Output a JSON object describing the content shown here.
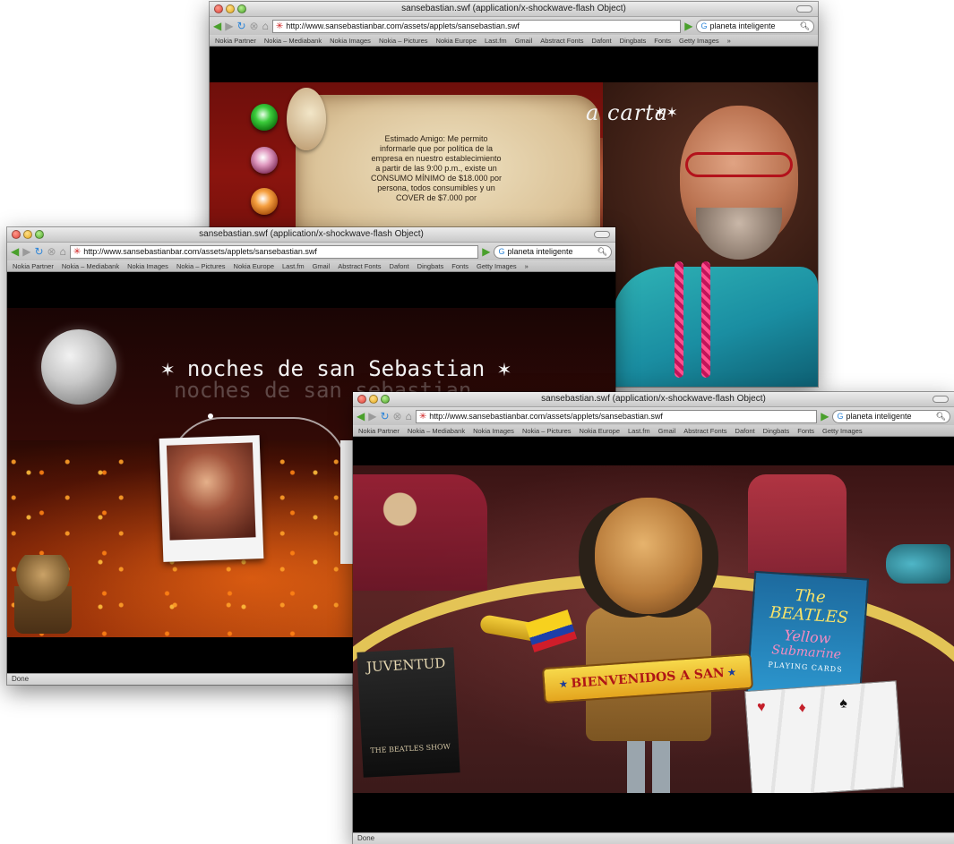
{
  "windows": {
    "carta": {
      "title": "sansebastian.swf (application/x-shockwave-flash Object)",
      "url": "http://www.sansebastianbar.com/assets/applets/sansebastian.swf",
      "search": "planeta inteligente",
      "letter": "Estimado Amigo: Me permito informarle que por política de la empresa en nuestro establecimiento a partir de las 9:00 p.m., existe un CONSUMO MÍNIMO de $18.000 por persona, todos consumibles y un COVER de $7.000 por",
      "logo_partial": "a carta",
      "stars": "✶✶"
    },
    "noches": {
      "title": "sansebastian.swf (application/x-shockwave-flash Object)",
      "url": "http://www.sansebastianbar.com/assets/applets/sansebastian.swf",
      "search": "planeta inteligente",
      "heading": "noches de san Sebastian",
      "heading_shadow": "noches de san sebastian",
      "status": "Done"
    },
    "bienvenidos": {
      "title": "sansebastian.swf (application/x-shockwave-flash Object)",
      "url": "http://www.sansebastianbar.com/assets/applets/sansebastian.swf",
      "search": "planeta inteligente",
      "banner": "BIENVENIDOS A SAN",
      "beatles_box": {
        "line1": "The BEATLES",
        "line2": "Yellow",
        "line3": "Submarine",
        "line4": "PLAYING CARDS"
      },
      "juventud": "JUVENTUD",
      "juventud_sub": "THE BEATLES SHOW",
      "status": "Done"
    }
  },
  "bookmarks": [
    "Nokia Partner",
    "Nokia – Mediabank",
    "Nokia Images",
    "Nokia – Pictures",
    "Nokia Europe",
    "Last.fm",
    "Gmail",
    "Abstract Fonts",
    "Dafont",
    "Dingbats",
    "Fonts",
    "Getty Images",
    "»"
  ],
  "colors": {
    "title_bar": "#d6d6d6",
    "flash_bg": "#000000",
    "banner_yellow": "#f7d94b",
    "banner_text": "#b01616"
  }
}
